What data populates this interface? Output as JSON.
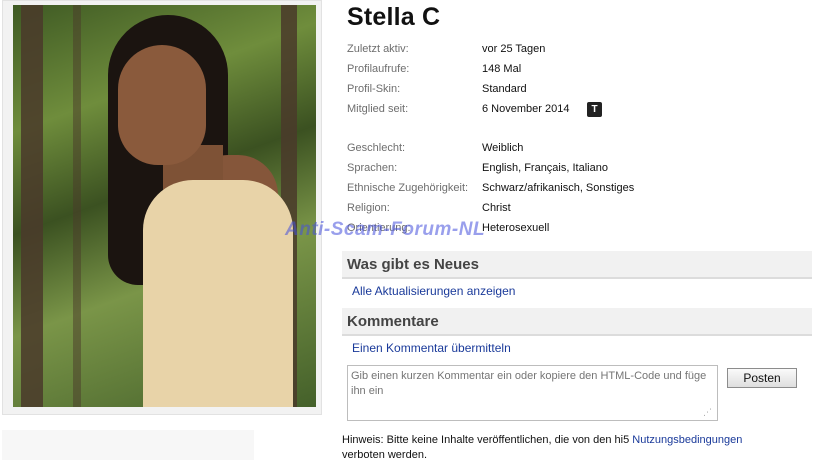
{
  "profile": {
    "name": "Stella C",
    "rows_top": [
      {
        "label": "Zuletzt aktiv:",
        "value": "vor 25 Tagen"
      },
      {
        "label": "Profilaufrufe:",
        "value": "148 Mal"
      },
      {
        "label": "Profil-Skin:",
        "value": "Standard"
      },
      {
        "label": "Mitglied seit:",
        "value": "6 November 2014"
      }
    ],
    "rows_bottom": [
      {
        "label": "Geschlecht:",
        "value": "Weiblich"
      },
      {
        "label": "Sprachen:",
        "value": "English, Français, Italiano"
      },
      {
        "label": "Ethnische Zugehörigkeit:",
        "value": "Schwarz/afrikanisch, Sonstiges"
      },
      {
        "label": "Religion:",
        "value": "Christ"
      },
      {
        "label": "Orientierung:",
        "value": "Heterosexuell"
      }
    ],
    "member_icon_glyph": "T"
  },
  "watermark": "Anti-Scam-Forum-NL",
  "news": {
    "title": "Was gibt es Neues",
    "link": "Alle Aktualisierungen anzeigen"
  },
  "comments": {
    "title": "Kommentare",
    "link": "Einen Kommentar übermitteln",
    "placeholder": "Gib einen kurzen Kommentar ein oder kopiere den HTML-Code und füge ihn ein",
    "post_label": "Posten"
  },
  "notice": {
    "prefix": "Hinweis: Bitte keine Inhalte veröffentlichen, die von den hi5 ",
    "link": "Nutzungsbedingungen",
    "suffix": "verboten werden."
  },
  "colors": {
    "link": "#1a3a9a",
    "label": "#6e6e6e",
    "section_bg": "#f1f1f1",
    "watermark": "#4650dc"
  }
}
